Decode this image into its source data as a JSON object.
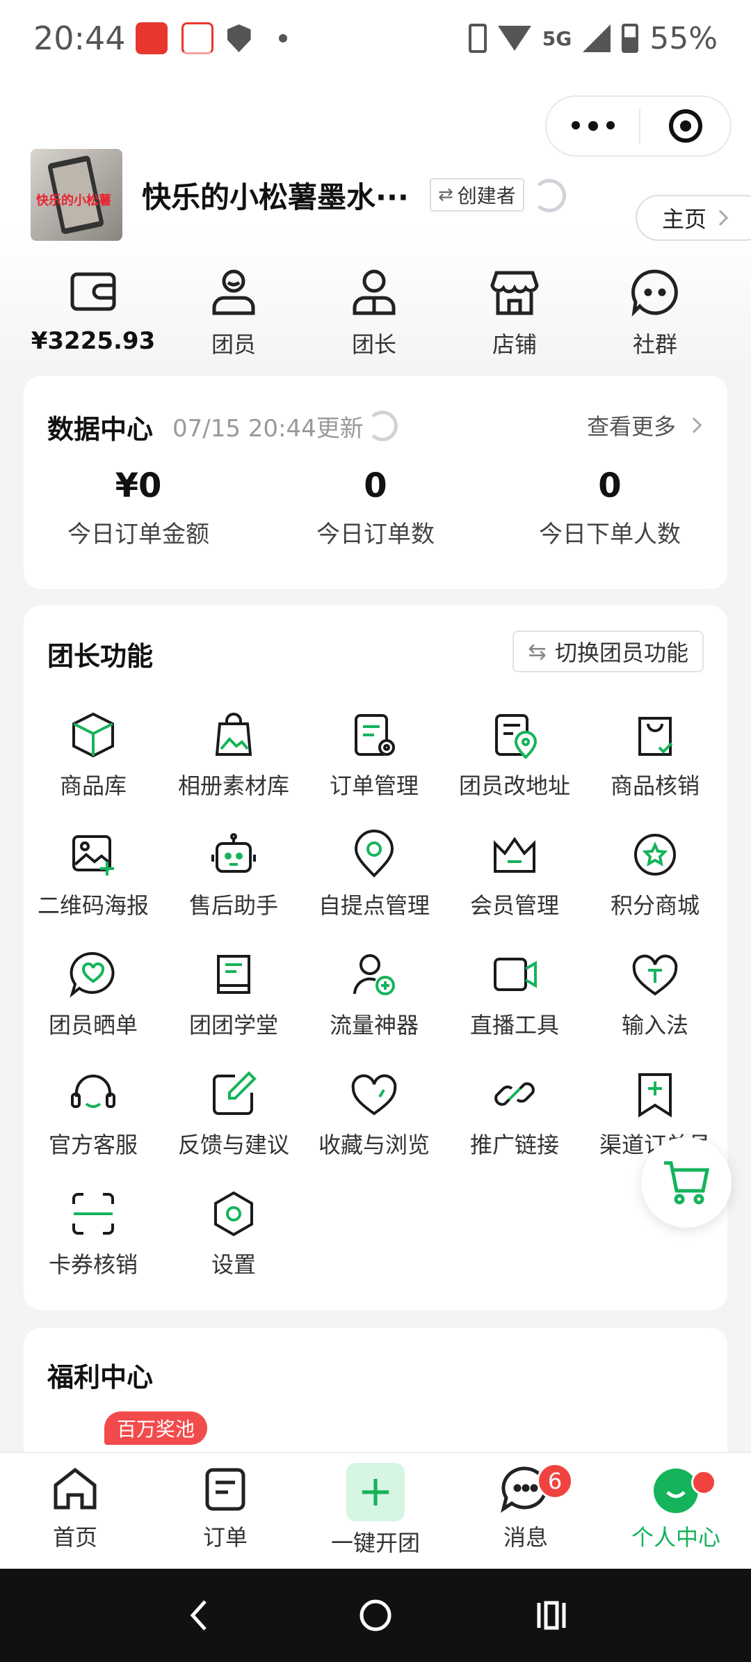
{
  "status_bar": {
    "time": "20:44",
    "network": "5G",
    "battery": "55%"
  },
  "profile": {
    "name": "快乐的小松薯墨水···",
    "role": "创建者",
    "home_label": "主页",
    "avatar_text": "快乐的小松薯"
  },
  "quick_entries": [
    {
      "icon": "wallet-icon",
      "label": "¥3225.93"
    },
    {
      "icon": "member-icon",
      "label": "团员"
    },
    {
      "icon": "leader-icon",
      "label": "团长"
    },
    {
      "icon": "store-icon",
      "label": "店铺"
    },
    {
      "icon": "community-icon",
      "label": "社群"
    }
  ],
  "data_center": {
    "title": "数据中心",
    "update_time": "07/15 20:44更新",
    "see_more": "查看更多",
    "stats": [
      {
        "value": "¥0",
        "label": "今日订单金额"
      },
      {
        "value": "0",
        "label": "今日订单数"
      },
      {
        "value": "0",
        "label": "今日下单人数"
      }
    ]
  },
  "leader_functions": {
    "title": "团长功能",
    "switch_label": "切换团员功能",
    "items": [
      {
        "icon": "cube-icon",
        "label": "商品库"
      },
      {
        "icon": "photo-bag-icon",
        "label": "相册素材库"
      },
      {
        "icon": "order-manage-icon",
        "label": "订单管理"
      },
      {
        "icon": "address-change-icon",
        "label": "团员改地址"
      },
      {
        "icon": "verify-bag-icon",
        "label": "商品核销"
      },
      {
        "icon": "qr-poster-icon",
        "label": "二维码海报"
      },
      {
        "icon": "robot-icon",
        "label": "售后助手"
      },
      {
        "icon": "pickup-point-icon",
        "label": "自提点管理"
      },
      {
        "icon": "crown-icon",
        "label": "会员管理"
      },
      {
        "icon": "star-icon",
        "label": "积分商城"
      },
      {
        "icon": "chat-heart-icon",
        "label": "团员晒单"
      },
      {
        "icon": "book-icon",
        "label": "团团学堂"
      },
      {
        "icon": "user-add-icon",
        "label": "流量神器"
      },
      {
        "icon": "video-icon",
        "label": "直播工具"
      },
      {
        "icon": "heart-text-icon",
        "label": "输入法"
      },
      {
        "icon": "headset-icon",
        "label": "官方客服"
      },
      {
        "icon": "edit-icon",
        "label": "反馈与建议"
      },
      {
        "icon": "heart-icon",
        "label": "收藏与浏览"
      },
      {
        "icon": "link-icon",
        "label": "推广链接"
      },
      {
        "icon": "bookmark-plus-icon",
        "label": "渠道订单员"
      },
      {
        "icon": "scan-icon",
        "label": "卡券核销"
      },
      {
        "icon": "settings-hex-icon",
        "label": "设置"
      }
    ]
  },
  "welfare": {
    "title": "福利中心",
    "badge": "百万奖池"
  },
  "tab_bar": {
    "items": [
      {
        "icon": "home-icon",
        "label": "首页"
      },
      {
        "icon": "order-icon",
        "label": "订单"
      },
      {
        "icon": "plus-icon",
        "label": "一键开团"
      },
      {
        "icon": "message-icon",
        "label": "消息",
        "badge": "6"
      },
      {
        "icon": "profile-icon",
        "label": "个人中心"
      }
    ]
  },
  "colors": {
    "accent": "#15b35a",
    "badge": "#f0433f"
  }
}
